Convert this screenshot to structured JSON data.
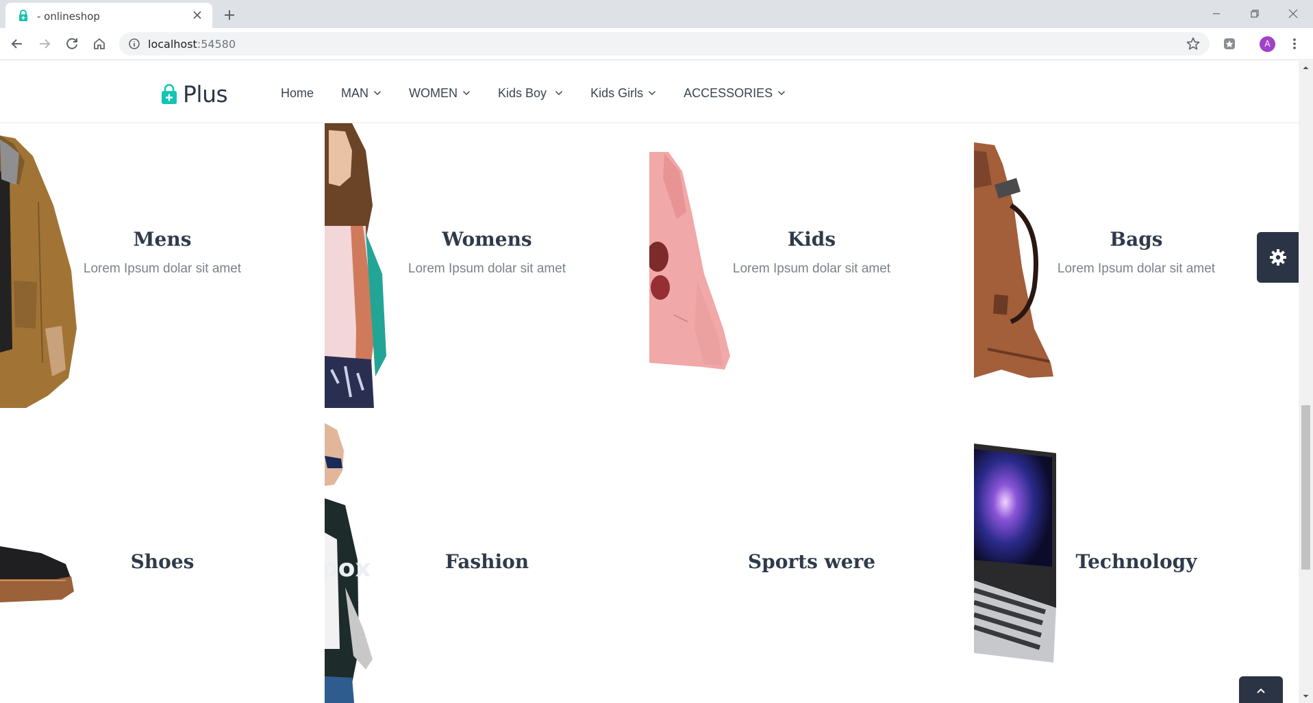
{
  "browser": {
    "tab_title": "- onlineshop",
    "url_host": "localhost",
    "url_port": ":54580",
    "avatar_letter": "A"
  },
  "site": {
    "logo_text": "Plus",
    "brand_color": "#14c4b4",
    "dark_color": "#2b3444",
    "nav": [
      {
        "label": "Home",
        "has_dropdown": false
      },
      {
        "label": "MAN",
        "has_dropdown": true
      },
      {
        "label": "WOMEN",
        "has_dropdown": true
      },
      {
        "label": "Kids Boy",
        "has_dropdown": true
      },
      {
        "label": "Kids Girls",
        "has_dropdown": true
      },
      {
        "label": "ACCESSORIES",
        "has_dropdown": true
      }
    ]
  },
  "categories": [
    {
      "title": "Mens",
      "subtitle": "Lorem Ipsum dolar sit amet",
      "image": "brown-jacket"
    },
    {
      "title": "Womens",
      "subtitle": "Lorem Ipsum dolar sit amet",
      "image": "woman-scarf"
    },
    {
      "title": "Kids",
      "subtitle": "Lorem Ipsum dolar sit amet",
      "image": "pink-hoodie"
    },
    {
      "title": "Bags",
      "subtitle": "Lorem Ipsum dolar sit amet",
      "image": "leather-bag"
    },
    {
      "title": "Shoes",
      "subtitle": "",
      "image": "sneaker"
    },
    {
      "title": "Fashion",
      "subtitle": "",
      "image": "man-blazer"
    },
    {
      "title": "Sports were",
      "subtitle": "",
      "image": "none"
    },
    {
      "title": "Technology",
      "subtitle": "",
      "image": "laptop"
    }
  ],
  "floating": {
    "settings_icon": "gear-icon",
    "back_to_top_icon": "chevron-up-icon"
  }
}
